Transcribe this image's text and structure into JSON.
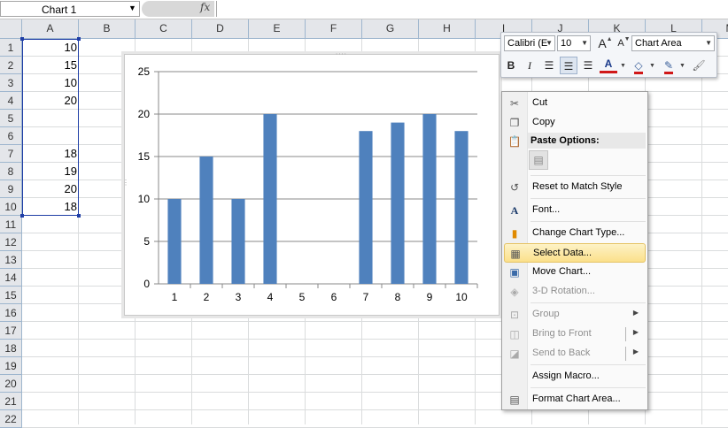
{
  "formula_bar": {
    "name_box": "Chart 1",
    "fx_label": "fx"
  },
  "columns": [
    "A",
    "B",
    "C",
    "D",
    "E",
    "F",
    "G",
    "H",
    "I",
    "J",
    "K",
    "L",
    "M"
  ],
  "rows": [
    "1",
    "2",
    "3",
    "4",
    "5",
    "6",
    "7",
    "8",
    "9",
    "10",
    "11",
    "12",
    "13",
    "14",
    "15",
    "16",
    "17",
    "18",
    "19",
    "20",
    "21",
    "22"
  ],
  "cells_A": [
    "10",
    "15",
    "10",
    "20",
    "",
    "",
    "18",
    "19",
    "20",
    "18"
  ],
  "chart_data": {
    "type": "bar",
    "categories": [
      "1",
      "2",
      "3",
      "4",
      "5",
      "6",
      "7",
      "8",
      "9",
      "10"
    ],
    "series": [
      {
        "values": [
          10,
          15,
          10,
          20,
          null,
          null,
          18,
          19,
          20,
          18
        ]
      }
    ],
    "yticks": [
      "0",
      "5",
      "10",
      "15",
      "20",
      "25"
    ],
    "ylim": [
      0,
      25
    ],
    "grid": true,
    "colors": {
      "bar": "#4f81bd"
    }
  },
  "mini_toolbar": {
    "font_name": "Calibri (E",
    "font_size": "10",
    "grow_font_label": "A",
    "shrink_font_label": "A",
    "element_selector": "Chart Area",
    "bold_label": "B",
    "italic_label": "I",
    "font_color_label": "A"
  },
  "context_menu": {
    "cut": "Cut",
    "copy": "Copy",
    "paste_options": "Paste Options:",
    "reset_style": "Reset to Match Style",
    "font": "Font...",
    "change_chart_type": "Change Chart Type...",
    "select_data": "Select Data...",
    "move_chart": "Move Chart...",
    "rotation": "3-D Rotation...",
    "group": "Group",
    "bring_front": "Bring to Front",
    "send_back": "Send to Back",
    "assign_macro": "Assign Macro...",
    "format_chart_area": "Format Chart Area..."
  }
}
